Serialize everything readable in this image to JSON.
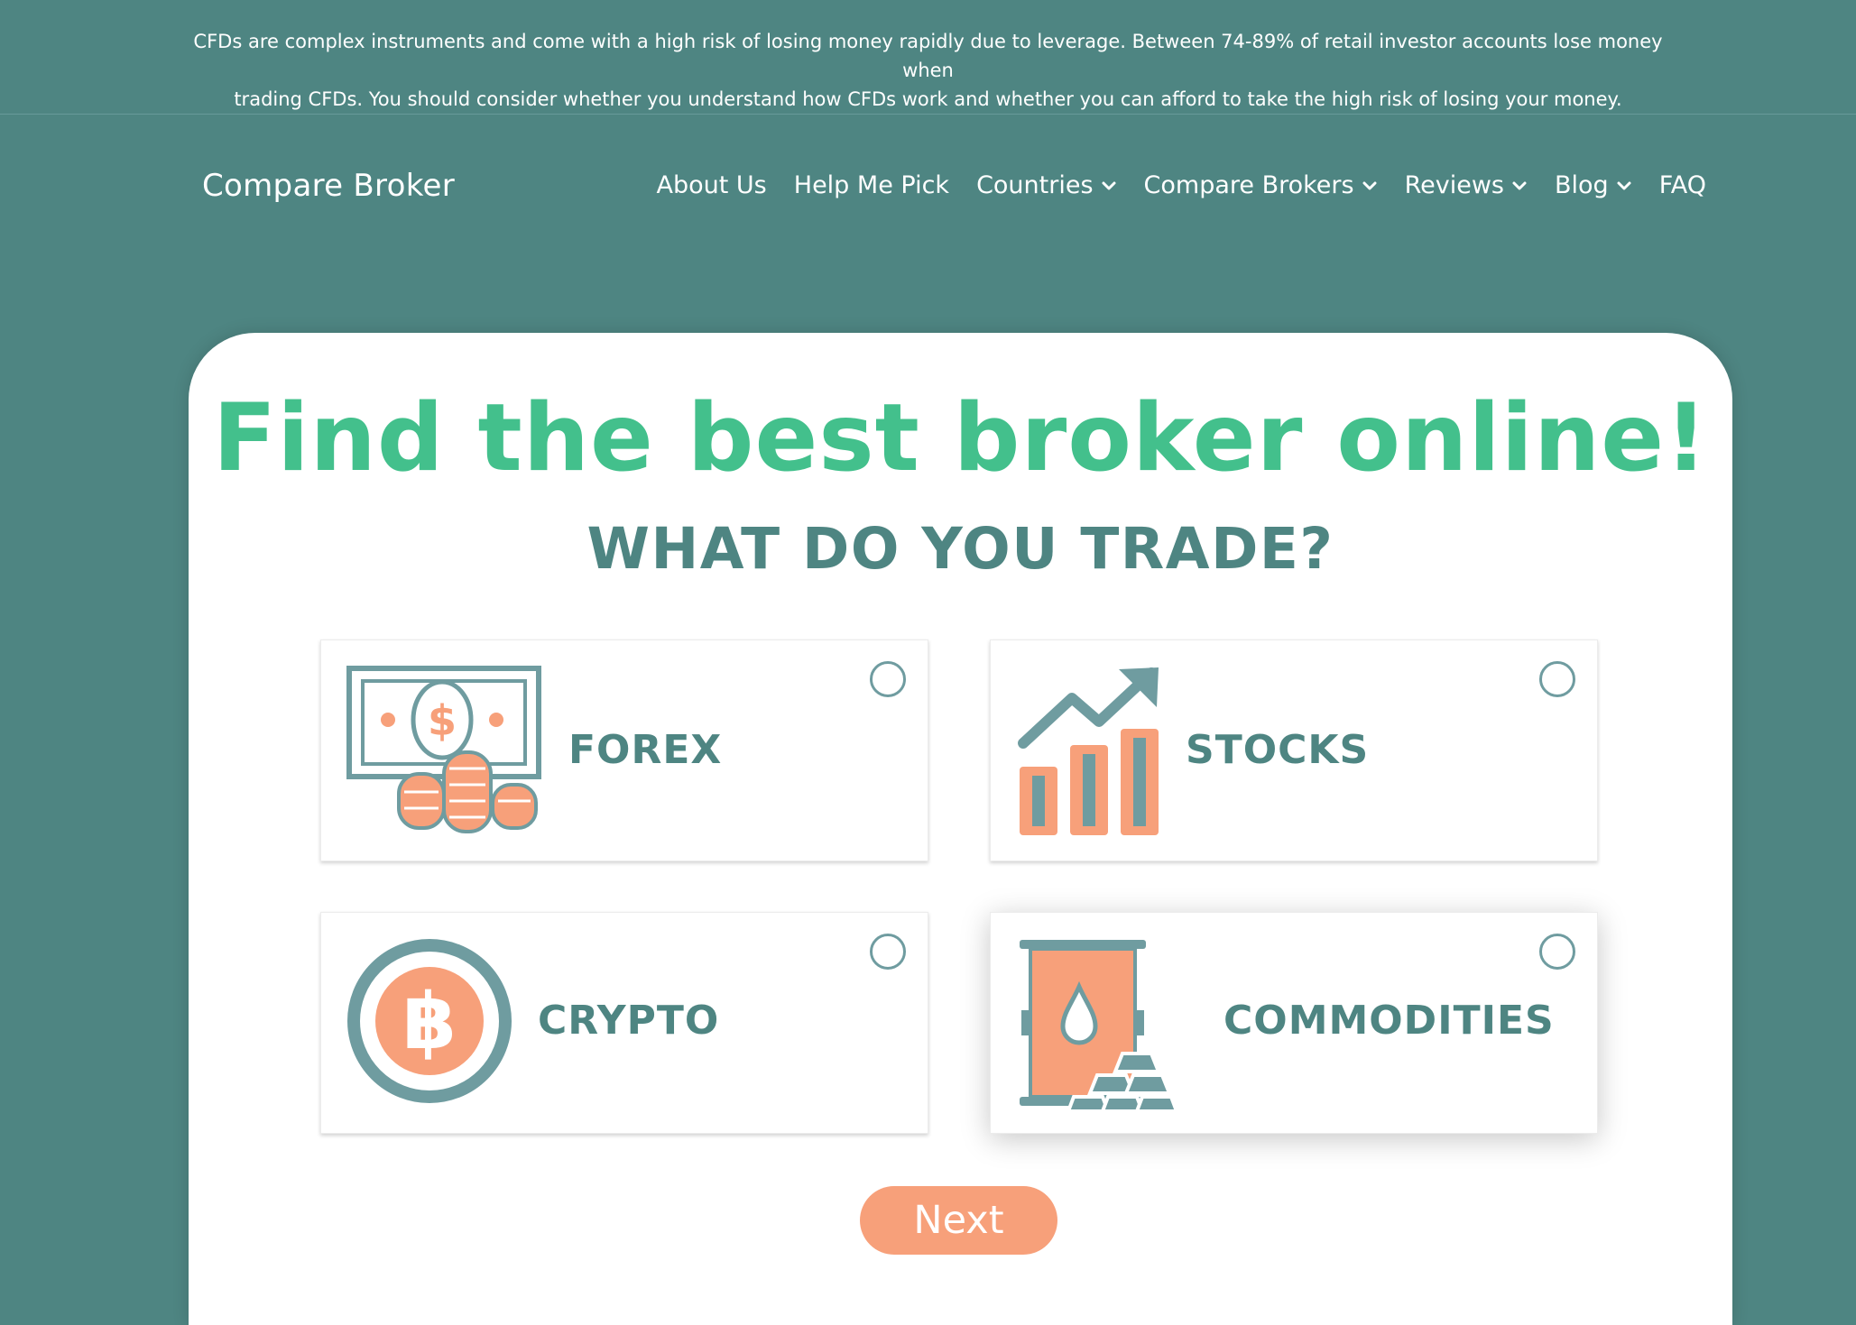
{
  "disclaimer": {
    "line1": "CFDs are complex instruments and come with a high risk of losing money rapidly due to leverage. Between 74-89% of retail investor accounts lose money when",
    "line2": "trading CFDs. You should consider whether you understand how CFDs work and whether you can afford to take the high risk of losing your money."
  },
  "header": {
    "logo": "Compare Broker",
    "nav": [
      {
        "label": "About Us",
        "dropdown": false
      },
      {
        "label": "Help Me Pick",
        "dropdown": false
      },
      {
        "label": "Countries",
        "dropdown": true
      },
      {
        "label": "Compare Brokers",
        "dropdown": true
      },
      {
        "label": "Reviews",
        "dropdown": true
      },
      {
        "label": "Blog",
        "dropdown": true
      },
      {
        "label": "FAQ",
        "dropdown": false
      }
    ]
  },
  "hero": {
    "headline": "Find the best broker online!",
    "question": "WHAT DO YOU TRADE?"
  },
  "options": [
    {
      "label": "FOREX",
      "icon": "cash-coins-icon",
      "selected": false
    },
    {
      "label": "STOCKS",
      "icon": "growth-chart-icon",
      "selected": false
    },
    {
      "label": "CRYPTO",
      "icon": "bitcoin-icon",
      "selected": false
    },
    {
      "label": "COMMODITIES",
      "icon": "oil-barrel-gold-icon",
      "selected": false
    }
  ],
  "next_label": "Next",
  "colors": {
    "background": "#4e8582",
    "accent_green": "#43c08c",
    "accent_orange": "#f7a07a",
    "icon_teal": "#6f9ca0"
  }
}
